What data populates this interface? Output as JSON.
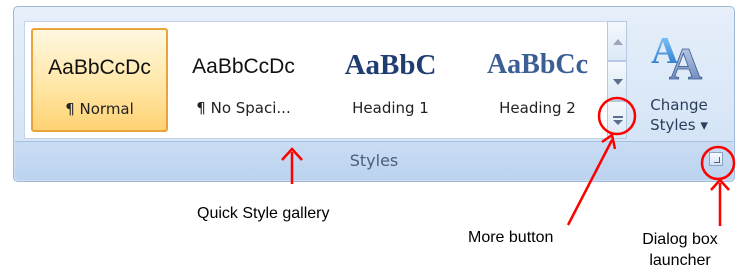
{
  "styles_group": {
    "label": "Styles",
    "gallery": [
      {
        "sample": "AaBbCcDc",
        "name": "¶ Normal",
        "selected": true
      },
      {
        "sample": "AaBbCcDc",
        "name": "¶ No Spaci..."
      },
      {
        "sample": "AaBbC",
        "name": "Heading 1"
      },
      {
        "sample": "AaBbCc",
        "name": "Heading 2"
      }
    ],
    "change_styles": {
      "line1": "Change",
      "line2": "Styles ▾"
    }
  },
  "annotations": {
    "gallery": "Quick Style gallery",
    "more": "More button",
    "launcher_line1": "Dialog box",
    "launcher_line2": "launcher"
  },
  "colors": {
    "annotation": "#ff0000",
    "selected_tile": "#ffd274"
  }
}
